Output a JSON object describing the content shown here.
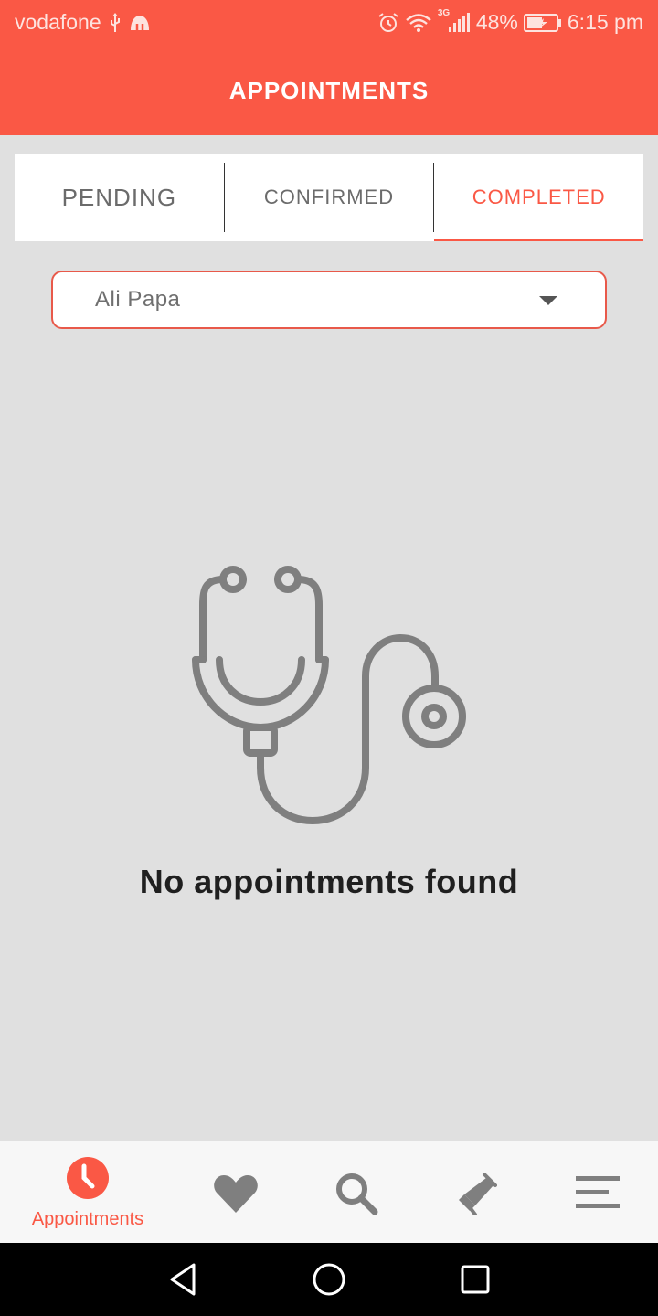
{
  "status_bar": {
    "carrier": "vodafone",
    "network": "3G",
    "battery": "48%",
    "time": "6:15 pm",
    "icons": [
      "usb-icon",
      "notification-icon",
      "alarm-icon",
      "wifi-icon",
      "signal-icon",
      "battery-charging-icon"
    ]
  },
  "header": {
    "title": "APPOINTMENTS"
  },
  "tabs": [
    {
      "label": "PENDING",
      "active": false
    },
    {
      "label": "CONFIRMED",
      "active": false
    },
    {
      "label": "COMPLETED",
      "active": true
    }
  ],
  "filter": {
    "selected": "Ali Papa"
  },
  "empty_state": {
    "icon": "stethoscope-icon",
    "message": "No appointments found"
  },
  "bottom_nav": {
    "items": [
      {
        "icon": "clock-icon",
        "label": "Appointments",
        "active": true
      },
      {
        "icon": "heart-icon",
        "label": "",
        "active": false
      },
      {
        "icon": "search-icon",
        "label": "",
        "active": false
      },
      {
        "icon": "megaphone-icon",
        "label": "",
        "active": false
      },
      {
        "icon": "menu-icon",
        "label": "",
        "active": false
      }
    ]
  },
  "system_nav": {
    "icons": [
      "back-icon",
      "home-icon",
      "recents-icon"
    ]
  },
  "colors": {
    "accent": "#fa5845",
    "background": "#e0e0e0",
    "icon_gray": "#7f7f7f",
    "text_dark": "#1f1f1f"
  }
}
